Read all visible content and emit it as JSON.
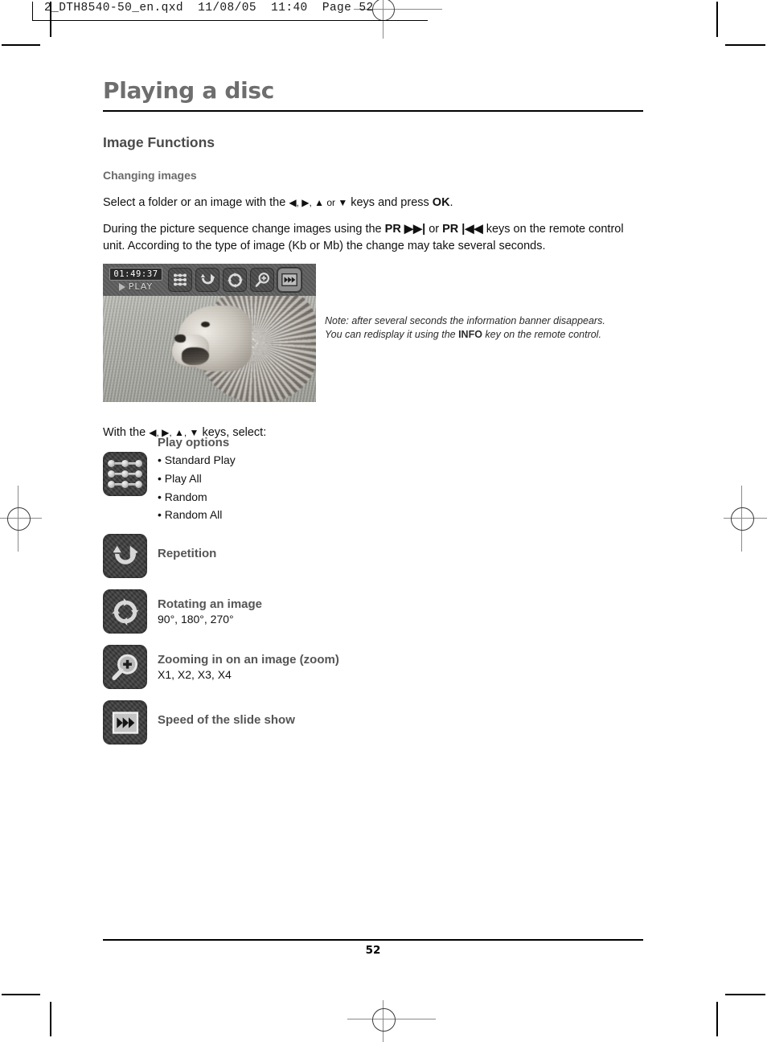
{
  "print_header": {
    "imprint": "2_DTH8540-50_en.qxd  11/08/05  11:40  Page 52"
  },
  "page": {
    "title": "Playing a disc",
    "section_heading": "Image Functions",
    "subsection_heading": "Changing images",
    "paragraph_1_before": "Select a folder or an image with the ",
    "paragraph_1_keys": "◀, ▶, ▲ or ▼",
    "paragraph_1_middle": " keys and press ",
    "paragraph_1_bold": "OK",
    "paragraph_1_end": ".",
    "paragraph_2_before": "During the picture sequence change images using the ",
    "paragraph_2_key_1": "PR ▶▶|",
    "paragraph_2_middle": " or ",
    "paragraph_2_key_2": "PR |◀◀",
    "paragraph_2_end": " keys on the remote control unit. According to the type of image (Kb or Mb) the change may take several seconds.",
    "keys_intro_before": "With the ",
    "keys_intro_keys": "◀, ▶, ▲, ▼",
    "keys_intro_end": " keys, select:",
    "page_number": "52"
  },
  "screenshot": {
    "timecode": "01:49:37",
    "play_label": "PLAY",
    "banner_icons": [
      {
        "name": "play-options-icon",
        "selected": false
      },
      {
        "name": "repetition-icon",
        "selected": false
      },
      {
        "name": "rotate-icon",
        "selected": false
      },
      {
        "name": "zoom-icon",
        "selected": false
      },
      {
        "name": "slideshow-speed-icon",
        "selected": true
      }
    ],
    "note_line_1": "Note: after several seconds the information banner disappears.",
    "note_line_2_before": "You can redisplay it using the ",
    "note_line_2_bold": "INFO",
    "note_line_2_after": " key on the remote control."
  },
  "functions": [
    {
      "icon": "play-options-icon",
      "title": "Play options",
      "bullets": [
        "Standard Play",
        "Play All",
        "Random",
        "Random All"
      ],
      "subtitle": ""
    },
    {
      "icon": "repetition-icon",
      "title": "Repetition",
      "bullets": [],
      "subtitle": ""
    },
    {
      "icon": "rotate-icon",
      "title": "Rotating an image",
      "bullets": [],
      "subtitle": "90°, 180°, 270°"
    },
    {
      "icon": "zoom-icon",
      "title": "Zooming in on an image (zoom)",
      "bullets": [],
      "subtitle": "X1, X2, X3, X4"
    },
    {
      "icon": "slideshow-speed-icon",
      "title": "Speed of the slide show",
      "bullets": [],
      "subtitle": ""
    }
  ],
  "colors": {
    "title_gray": "#6e6e6e",
    "heading_gray": "#555555",
    "body_black": "#111111",
    "icon_dark": "#3b3b3b"
  }
}
